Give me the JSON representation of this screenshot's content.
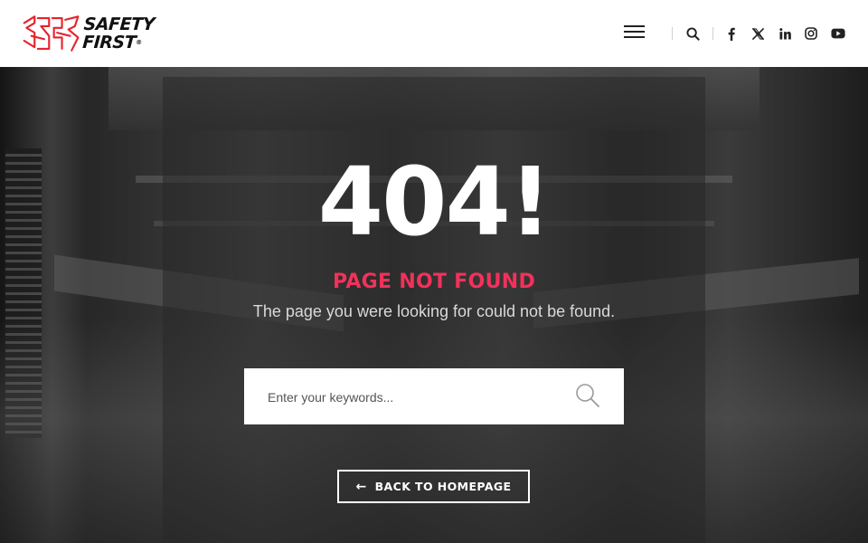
{
  "header": {
    "logo": {
      "line1": "SAFETY",
      "line2": "FIRST",
      "reg": "®",
      "mark_color": "#e5232c"
    },
    "icons": [
      "menu-icon",
      "search-icon",
      "facebook-icon",
      "x-twitter-icon",
      "linkedin-icon",
      "instagram-icon",
      "youtube-icon"
    ]
  },
  "error": {
    "code": "404!",
    "title": "PAGE NOT FOUND",
    "message": "The page you were looking for could not be found."
  },
  "search": {
    "placeholder": "Enter your keywords..."
  },
  "back_button": {
    "arrow": "←",
    "label": "BACK TO HOMEPAGE"
  },
  "colors": {
    "accent": "#f2315a",
    "brand_red": "#e5232c"
  }
}
